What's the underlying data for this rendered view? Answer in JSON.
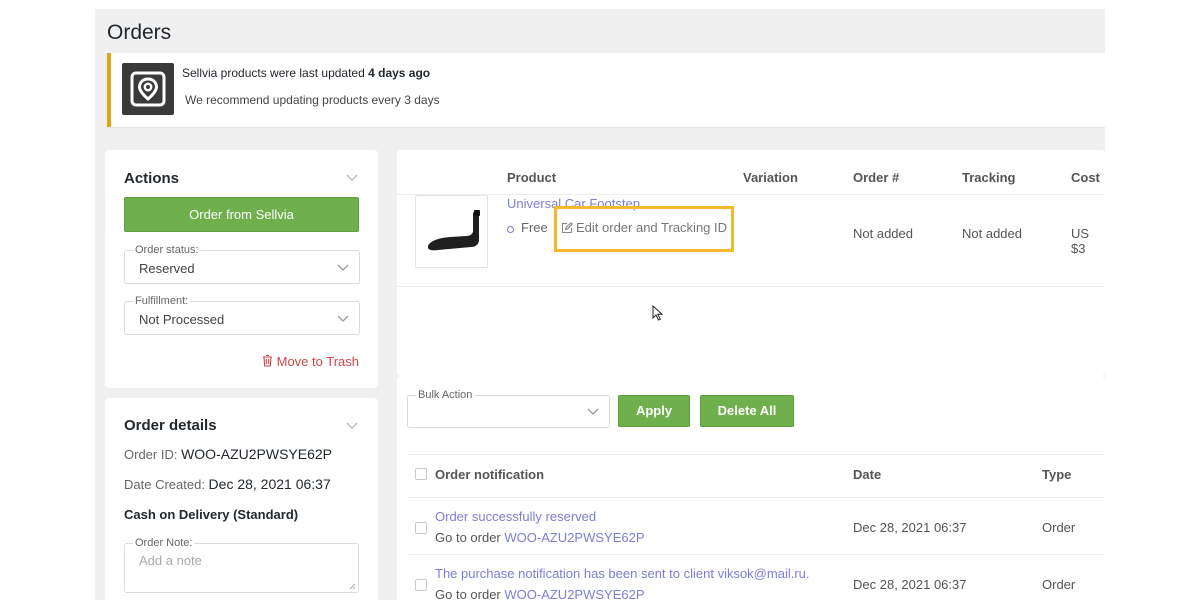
{
  "page": {
    "title": "Orders"
  },
  "notice": {
    "line1": "Sellvia products were last updated ",
    "line1_bold": "4 days ago",
    "line2": "We recommend updating products every 3 days"
  },
  "actions": {
    "title": "Actions",
    "order_button": "Order from Sellvia",
    "order_status_label": "Order status:",
    "order_status_value": "Reserved",
    "fulfillment_label": "Fulfillment:",
    "fulfillment_value": "Not Processed",
    "trash_label": "Move to Trash"
  },
  "order_details": {
    "title": "Order details",
    "order_id_label": "Order ID: ",
    "order_id": "WOO-AZU2PWSYE62P",
    "date_label": "Date Created: ",
    "date": "Dec 28, 2021 06:37",
    "shipping": "Cash on Delivery (Standard)",
    "note_label": "Order Note:",
    "note_placeholder": "Add a note"
  },
  "products_table": {
    "headers": [
      "Product",
      "Variation",
      "Order #",
      "Tracking",
      "Cost"
    ],
    "row": {
      "name": "Universal Car Footstep",
      "shipping": "Free",
      "edit_link": "Edit order and Tracking ID",
      "order_no": "Not added",
      "tracking": "Not added",
      "cost": "US $3"
    }
  },
  "notifications": {
    "bulk_label": "Bulk Action",
    "apply": "Apply",
    "delete_all": "Delete All",
    "headers": [
      "Order notification",
      "Date",
      "Type"
    ],
    "rows": [
      {
        "title": "Order successfully reserved",
        "goto": "Go to order ",
        "order_id": "WOO-AZU2PWSYE62P",
        "date": "Dec 28, 2021 06:37",
        "type": "Order"
      },
      {
        "title": "The purchase notification has been sent to client viksok@mail.ru.",
        "goto": "Go to order ",
        "order_id": "WOO-AZU2PWSYE62P",
        "date": "Dec 28, 2021 06:37",
        "type": "Order"
      }
    ]
  },
  "colors": {
    "accent_green": "#6fb04d",
    "link": "#7b7ed6",
    "highlight": "#f6b92b",
    "notice_border": "#dba617",
    "trash": "#d0454c"
  }
}
